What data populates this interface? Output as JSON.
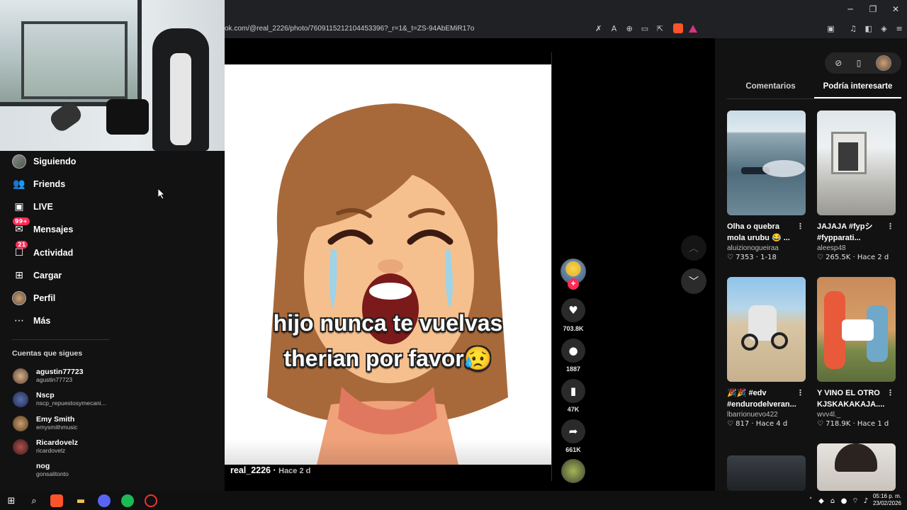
{
  "browser": {
    "url": "ok.com/@real_2226/photo/7609115212104453396?_r=1&_t=ZS-94AbEMiR17o",
    "window_controls": {
      "minimize": "─",
      "restore": "❐",
      "close": "✕"
    },
    "toolbar_icons": [
      "translate-off-icon",
      "translate-icon",
      "zoom-icon",
      "cast-icon",
      "share-icon",
      "brave-shield-icon",
      "brave-rewards-icon"
    ],
    "right_icons": [
      "sidebar-panel-icon",
      "media-icon",
      "sidebar-icon",
      "wallet-icon",
      "menu-icon"
    ]
  },
  "nav": {
    "items": [
      {
        "label": "Siguiendo",
        "icon": "avatar-icon"
      },
      {
        "label": "Friends",
        "icon": "friends-icon"
      },
      {
        "label": "LIVE",
        "icon": "live-icon"
      },
      {
        "label": "Mensajes",
        "icon": "messages-icon",
        "badge": "99+"
      },
      {
        "label": "Actividad",
        "icon": "activity-icon",
        "badge": "21"
      },
      {
        "label": "Cargar",
        "icon": "upload-icon"
      },
      {
        "label": "Perfil",
        "icon": "profile-icon"
      },
      {
        "label": "Más",
        "icon": "more-icon"
      }
    ],
    "following_header": "Cuentas que sigues",
    "accounts": [
      {
        "name": "agustin77723",
        "handle": "agustin77723"
      },
      {
        "name": "Nscp",
        "handle": "nscp_repuestosymecani..."
      },
      {
        "name": "Emy Smith",
        "handle": "emysmithmusic"
      },
      {
        "name": "Ricardovelz",
        "handle": "ricardovelz"
      },
      {
        "name": "nog",
        "handle": "gonsalitonto"
      }
    ]
  },
  "post": {
    "caption_line1": "hijo nunca te vuelvas",
    "caption_line2": "therian por favor😥",
    "author": "real_2226",
    "time": "Hace 2 d",
    "likes": "703.8K",
    "comments": "1887",
    "saves": "47K",
    "shares": "661K"
  },
  "right_panel": {
    "tabs": [
      "Comentarios",
      "Podría interesarte"
    ],
    "active_tab": 1,
    "cards": [
      {
        "title": "Olha o quebra mola urubu 😂 ...",
        "user": "aluizionogueiraa",
        "likes": "7353",
        "time": "1-18"
      },
      {
        "title": "JAJAJA #fypシ #fypparati...",
        "user": "aleesp48",
        "likes": "265.5K",
        "time": "Hace 2 d"
      },
      {
        "title": "🎉🎉 #edv #endurodelveran...",
        "user": "lbarrionuevo422",
        "likes": "817",
        "time": "Hace 4 d"
      },
      {
        "title": "Y VINO EL OTRO KJSKAKAKAJA....",
        "user": "wvv4l._",
        "likes": "718.9K",
        "time": "Hace 1 d"
      }
    ]
  },
  "taskbar": {
    "time": "05:16 p. m.",
    "date": "23/02/2026"
  }
}
